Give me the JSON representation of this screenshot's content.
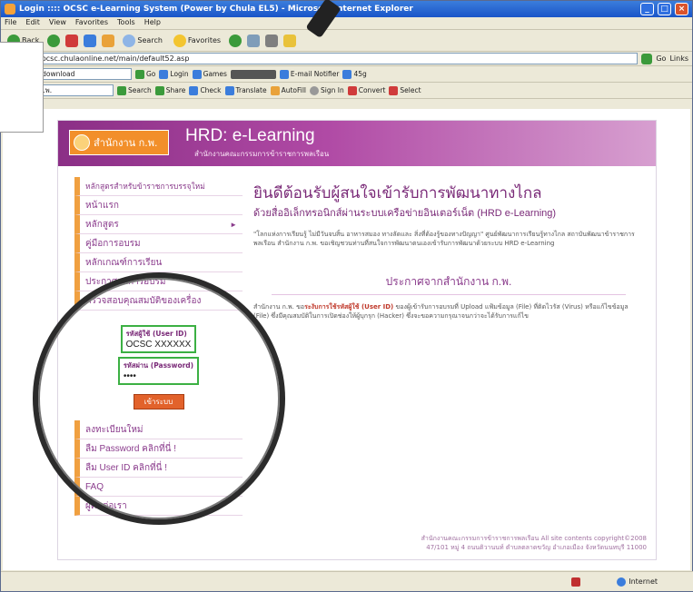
{
  "window": {
    "title": "Login :::: OCSC e-Learning System (Power by Chula EL5) - Microsoft Internet Explorer",
    "min": "_",
    "max": "□",
    "close": "×"
  },
  "menu": [
    "File",
    "Edit",
    "View",
    "Favorites",
    "Tools",
    "Help"
  ],
  "toolbar": {
    "back": "Back",
    "search": "Search",
    "favorites": "Favorites"
  },
  "address": {
    "label": "ss",
    "url": "http://ocsc.chulaonline.net/main/default52.asp",
    "go": "Go",
    "links": "Links"
  },
  "toolbar2": {
    "field": "np naipol download",
    "go": "Go",
    "login": "Login",
    "games": "Games",
    "email": "E-mail Notifier",
    "temp": "45g",
    "value": "45"
  },
  "toolbar3": {
    "field": "สำนักงาน ก.พ.",
    "search": "Search",
    "share": "Share",
    "check": "Check",
    "translate": "Translate",
    "autofill": "AutoFill",
    "signin": "Sign In",
    "convert": "Convert",
    "select": "Select"
  },
  "site": {
    "logo": "สำนักงาน ก.พ.",
    "title": "HRD: e-Learning",
    "subtitle": "สำนักงานคณะกรรมการข้าราชการพลเรือน",
    "nav": [
      {
        "label": "หลักสูตรสำหรับข้าราชการบรรจุใหม่",
        "arrow": ""
      },
      {
        "label": "หน้าแรก",
        "arrow": ""
      },
      {
        "label": "หลักสูตร",
        "arrow": "►"
      },
      {
        "label": "คู่มือการอบรม",
        "arrow": ""
      },
      {
        "label": "หลักเกณฑ์การเรียน",
        "arrow": ""
      },
      {
        "label": "ประกาศผลการอบรม",
        "arrow": ""
      },
      {
        "label": "ตรวจสอบคุณสมบัติของเครื่อง",
        "arrow": ""
      }
    ],
    "login": {
      "user_label": "รหัสผู้ใช้ (User ID)",
      "user_value": "OCSC XXXXXX",
      "pass_label": "รหัสผ่าน (Password)",
      "pass_value": "••••",
      "button": "เข้าระบบ"
    },
    "nav2": [
      {
        "label": "ลงทะเบียนใหม่"
      },
      {
        "label": "ลืม Password คลิกที่นี่ !"
      },
      {
        "label": "ลืม User ID คลิกที่นี่ !"
      },
      {
        "label": "FAQ"
      },
      {
        "label": "ผู้ติดต่อเรา"
      }
    ],
    "welcome": "ยินดีต้อนรับผู้สนใจเข้ารับการพัฒนาทางไกล",
    "welcome_sub": "ด้วยสื่ออิเล็กทรอนิกส์ผ่านระบบเครือข่ายอินเตอร์เน็ต (HRD e-Learning)",
    "para1": "\"โลกแห่งการเรียนรู้ ไม่มีวันจบสิ้น อาหารสมอง ทางลัดและ สิ่งที่ต้องรู้ของทางปัญญา\" ศูนย์พัฒนาการเรียนรู้ทางไกล สถาบันพัฒนาข้าราชการพลเรือน สำนักงาน ก.พ. ขอเชิญชวนท่านที่สนใจการพัฒนาตนเองเข้ารับการพัฒนาด้วยระบบ HRD e-Learning",
    "announce": "ประกาศจากสำนักงาน ก.พ.",
    "para2_a": "สำนักงาน ก.พ. ขอ",
    "para2_b": "ระงับการใช้รหัสผู้ใช้ (User ID)",
    "para2_c": " ของผู้เข้ารับการอบรมที่ Upload แฟ้มข้อมูล (File) ที่ติดไวรัส (Virus) หรือแก้ไขข้อมูล (File) ซึ่งมีคุณสมบัติในการเปิดช่องให้ผู้บุกรุก (Hacker) ซึ่งจะขอความกรุณาจนกว่าจะได้รับการแก้ไข",
    "footer1": "สำนักงานคณะกรรมการข้าราชการพลเรือน All site contents copyright©2008",
    "footer2": "47/101 หมู่ 4 ถนนติวานนท์ ตำบลตลาดขวัญ อำเภอเมือง จังหวัดนนทบุรี 11000"
  },
  "status": {
    "internet": "Internet"
  }
}
